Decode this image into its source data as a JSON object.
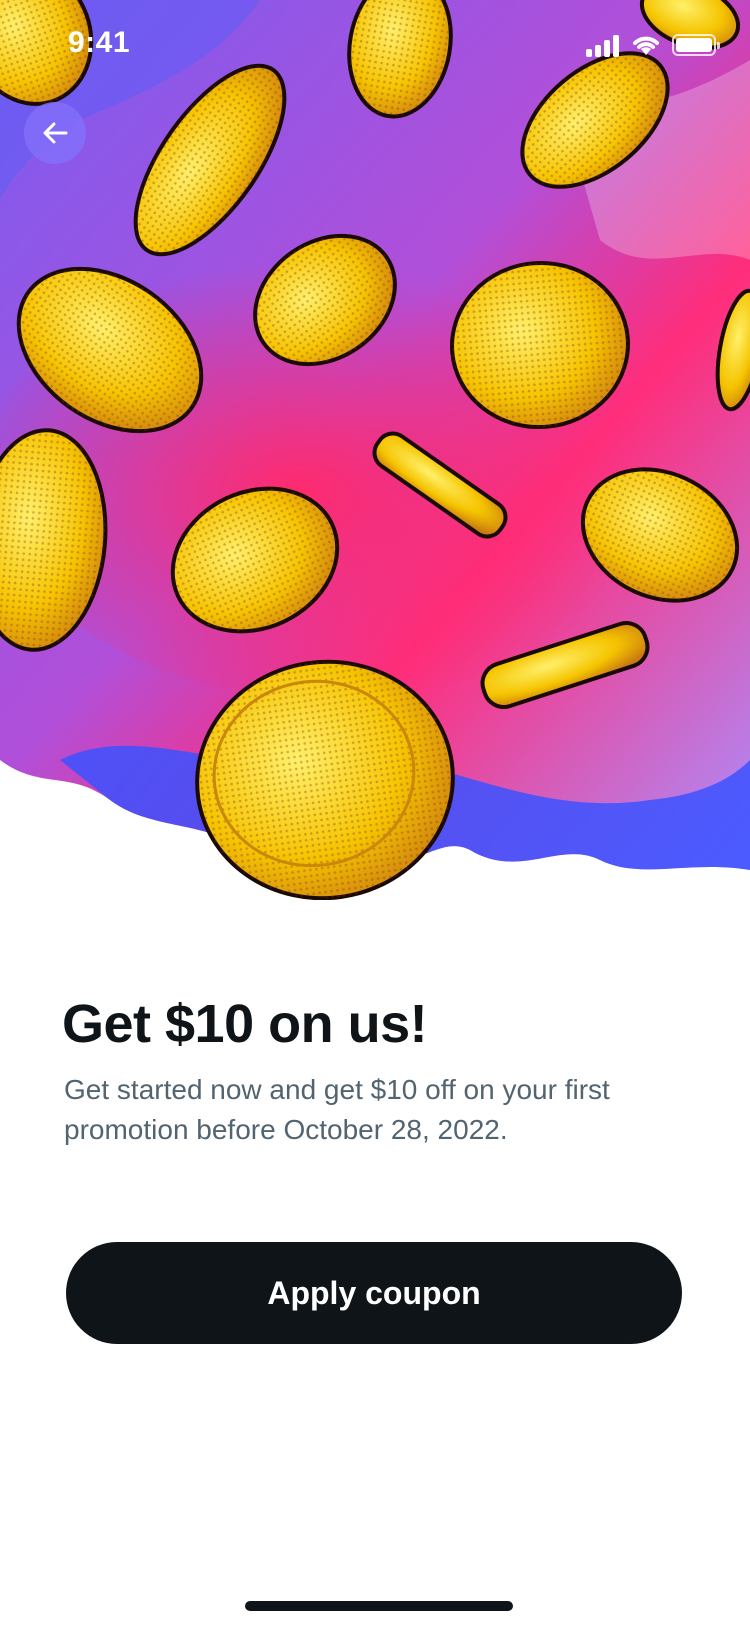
{
  "status_bar": {
    "time": "9:41",
    "icons": [
      "signal-icon",
      "wifi-icon",
      "battery-icon"
    ]
  },
  "header": {
    "back_icon": "arrow-left-icon"
  },
  "promo": {
    "title": "Get $10 on us!",
    "description": "Get started now and get $10 off on your first promotion before October 28, 2022.",
    "cta_label": "Apply coupon"
  },
  "colors": {
    "text_primary": "#0f1419",
    "text_secondary": "#536471",
    "button_bg": "#0f1419",
    "button_text": "#ffffff",
    "hero_purple": "#8b5cf6",
    "hero_pink": "#ff2d7a",
    "hero_blue": "#3b5bff",
    "coin_gold": "#f7c600"
  }
}
